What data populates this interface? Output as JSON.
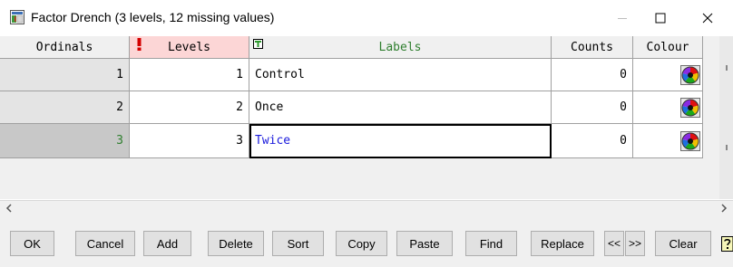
{
  "window": {
    "title": "Factor Drench (3 levels, 12 missing values)",
    "icon": "factor-spreadsheet-icon"
  },
  "grid": {
    "headers": {
      "ordinals": "Ordinals",
      "levels": "Levels",
      "labels": "Labels",
      "counts": "Counts",
      "colour": "Colour"
    },
    "header_colors": {
      "levels_bg": "#fcd6d6",
      "labels_text": "#2f7f2f"
    },
    "rows": [
      {
        "ordinal": "1",
        "level": "1",
        "label": "Control",
        "count": "0",
        "colour_icon": "color-wheel-icon"
      },
      {
        "ordinal": "2",
        "level": "2",
        "label": "Once",
        "count": "0",
        "colour_icon": "color-wheel-icon"
      },
      {
        "ordinal": "3",
        "level": "3",
        "label": "Twice",
        "count": "0",
        "colour_icon": "color-wheel-icon"
      }
    ],
    "selected_row": "3",
    "editing_text_color": "#1a1adc"
  },
  "toolbar": {
    "ok": "OK",
    "cancel": "Cancel",
    "add": "Add",
    "delete": "Delete",
    "sort": "Sort",
    "copy": "Copy",
    "paste": "Paste",
    "find": "Find",
    "replace": "Replace",
    "prev": "<<",
    "next": ">>",
    "clear": "Clear"
  }
}
